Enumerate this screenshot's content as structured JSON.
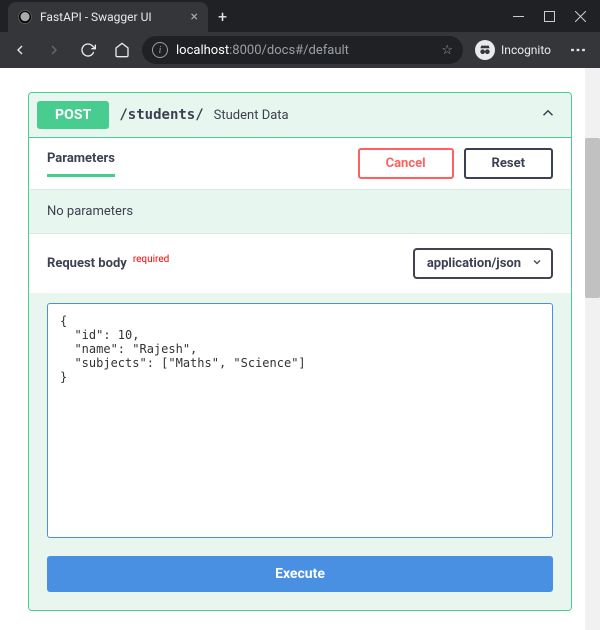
{
  "browser": {
    "tab_title": "FastAPI - Swagger UI",
    "url_host": "localhost",
    "url_path": ":8000/docs#/default",
    "incognito_label": "Incognito"
  },
  "operation": {
    "method": "POST",
    "path": "/students/",
    "summary": "Student Data"
  },
  "tabs": {
    "parameters_label": "Parameters",
    "cancel_label": "Cancel",
    "reset_label": "Reset"
  },
  "params": {
    "empty_message": "No parameters"
  },
  "request_body": {
    "label": "Request body",
    "required_label": "required",
    "content_type": "application/json",
    "editor_value": "{\n  \"id\": 10,\n  \"name\": \"Rajesh\",\n  \"subjects\": [\"Maths\", \"Science\"]\n}"
  },
  "actions": {
    "execute_label": "Execute"
  }
}
